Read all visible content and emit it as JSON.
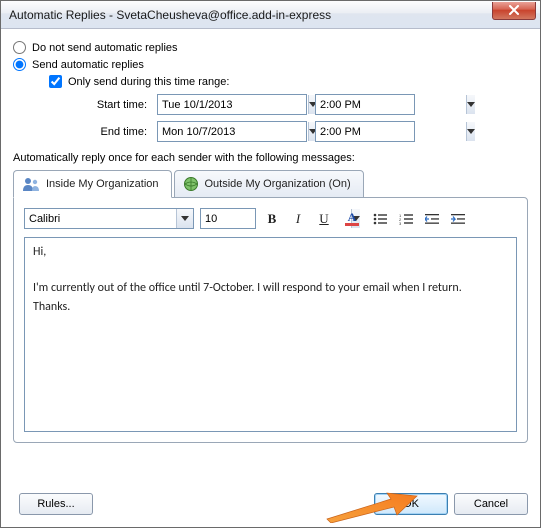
{
  "window": {
    "title": "Automatic Replies - SvetaCheusheva@office.add-in-express"
  },
  "options": {
    "doNotSend": "Do not send automatic replies",
    "sendAuto": "Send automatic replies",
    "onlyRange": "Only send during this time range:"
  },
  "range": {
    "startLabel": "Start time:",
    "endLabel": "End time:",
    "startDate": "Tue 10/1/2013",
    "startTime": "2:00 PM",
    "endDate": "Mon 10/7/2013",
    "endTime": "2:00 PM"
  },
  "sectionText": "Automatically reply once for each sender with the following messages:",
  "tabs": {
    "inside": "Inside My Organization",
    "outside": "Outside My Organization (On)"
  },
  "toolbar": {
    "font": "Calibri",
    "size": "10"
  },
  "message": {
    "line1": "Hi,",
    "line2": "I'm currently out of the office until 7-October. I will respond to your email when I return.",
    "line3": "Thanks."
  },
  "buttons": {
    "rules": "Rules...",
    "ok": "OK",
    "cancel": "Cancel"
  }
}
